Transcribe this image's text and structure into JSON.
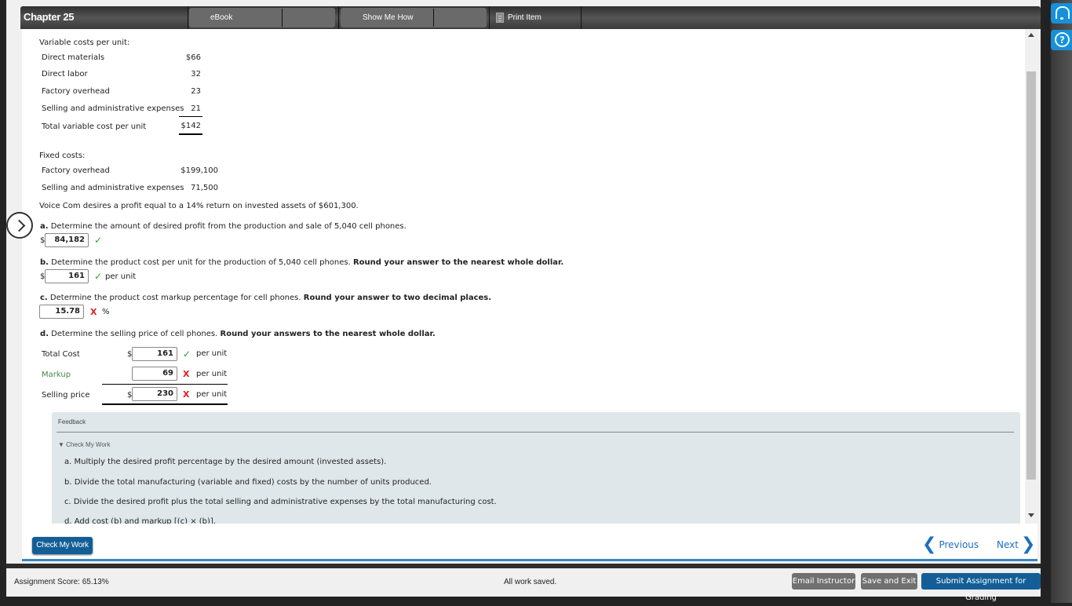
{
  "header": {
    "chapter": "Chapter 25",
    "ebook": "eBook",
    "show_me_how": "Show Me How",
    "print_item": "Print Item"
  },
  "variable_costs": {
    "title": "Variable costs per unit:",
    "rows": [
      {
        "label": "Direct materials",
        "value": "$66"
      },
      {
        "label": "Direct labor",
        "value": "32"
      },
      {
        "label": "Factory overhead",
        "value": "23"
      },
      {
        "label": "Selling and administrative expenses",
        "value": "21"
      }
    ],
    "total_label": "Total variable cost per unit",
    "total_value": "$142"
  },
  "fixed_costs": {
    "title": "Fixed costs:",
    "rows": [
      {
        "label": "Factory overhead",
        "value": "$199,100"
      },
      {
        "label": "Selling and administrative expenses",
        "value": "71,500"
      }
    ]
  },
  "intro": "Voice Com desires a profit equal to a 14% return on invested assets of $601,300.",
  "questions": {
    "a": {
      "letter": "a.",
      "text": "Determine the amount of desired profit from the production and sale of 5,040 cell phones.",
      "bold": "",
      "prefix": "$",
      "answer": "84,182",
      "status": "correct",
      "unit": ""
    },
    "b": {
      "letter": "b.",
      "text": "Determine the product cost per unit for the production of 5,040 cell phones.",
      "bold": "Round your answer to the nearest whole dollar.",
      "prefix": "$",
      "answer": "161",
      "status": "correct",
      "unit": "per unit"
    },
    "c": {
      "letter": "c.",
      "text": "Determine the product cost markup percentage for cell phones.",
      "bold": "Round your answer to two decimal places.",
      "answer": "15.78",
      "status": "incorrect",
      "unit": "%"
    },
    "d": {
      "letter": "d.",
      "text": "Determine the selling price of cell phones.",
      "bold": "Round your answers to the nearest whole dollar.",
      "rows": [
        {
          "label": "Total Cost",
          "prefix": "$",
          "answer": "161",
          "status": "correct",
          "unit": "per unit"
        },
        {
          "label": "Markup",
          "prefix": "",
          "answer": "69",
          "status": "incorrect",
          "unit": "per unit"
        },
        {
          "label": "Selling price",
          "prefix": "$",
          "answer": "230",
          "status": "incorrect",
          "unit": "per unit"
        }
      ]
    }
  },
  "status_icons": {
    "correct": "✓",
    "incorrect": "X"
  },
  "feedback": {
    "title": "Feedback",
    "toggle": "▼ Check My Work",
    "items": [
      "a. Multiply the desired profit percentage by the desired amount (invested assets).",
      "b. Divide the total manufacturing (variable and fixed) costs by the number of units produced.",
      "c. Divide the desired profit plus the total selling and administrative expenses by the total manufacturing cost.",
      "d. Add cost (b) and markup [(c) × (b)]."
    ]
  },
  "actions": {
    "check_my_work": "Check My Work",
    "previous": "Previous",
    "next": "Next"
  },
  "footer": {
    "score": "Assignment Score:  65.13%",
    "saved": "All work saved.",
    "email": "Email Instructor",
    "save_exit": "Save and Exit",
    "submit": "Submit Assignment for Grading"
  },
  "colors": {
    "accent": "#135e96",
    "correct": "#2e9e2e",
    "incorrect": "#e02020",
    "link": "#1f6fc2"
  }
}
